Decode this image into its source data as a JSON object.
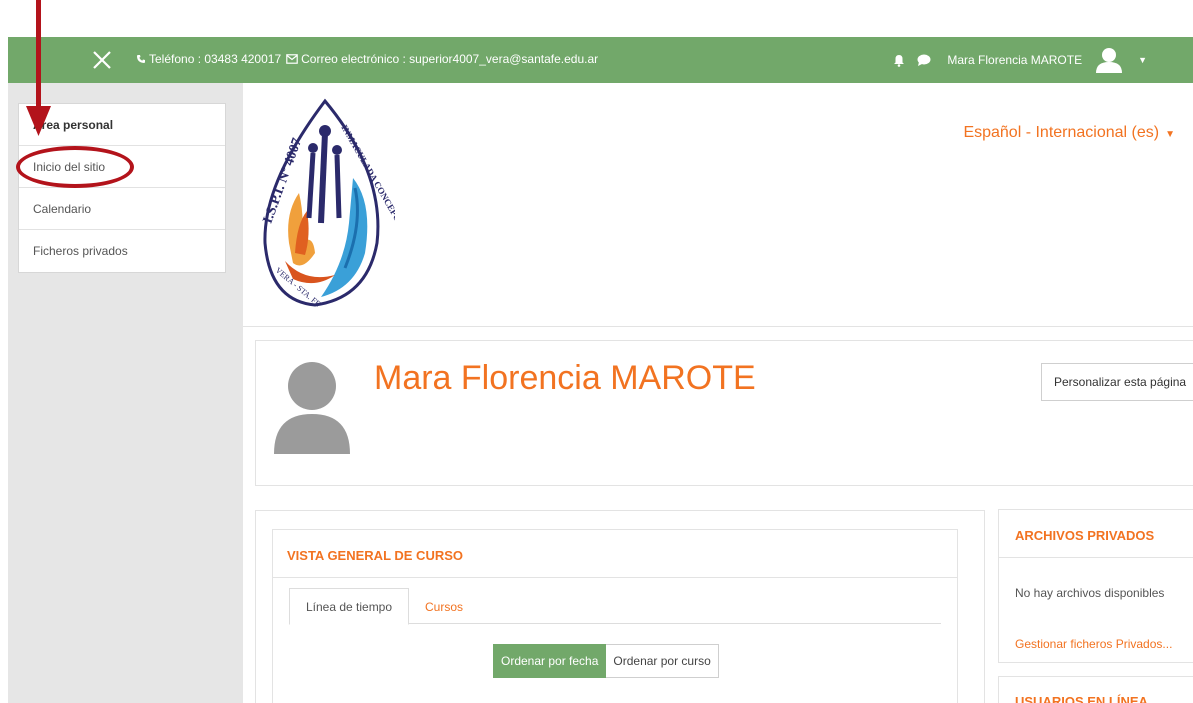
{
  "topbar": {
    "phone_label": "Teléfono : 03483 420017",
    "email_label": "Correo electrónico : superior4007_vera@santafe.edu.ar",
    "user_name": "Mara Florencia MAROTE",
    "icons": [
      "close-icon",
      "phone-icon",
      "mail-icon",
      "bell-icon",
      "chat-icon",
      "user-avatar-icon",
      "caret-down-icon"
    ]
  },
  "sidebar": {
    "items": [
      {
        "label": "Área personal",
        "bold": true
      },
      {
        "label": "Inicio del sitio"
      },
      {
        "label": "Calendario"
      },
      {
        "label": "Ficheros privados"
      }
    ]
  },
  "header": {
    "language": "Español - Internacional (es)",
    "logo_text": {
      "top": "I.S.P.I. Nº 4007",
      "right": "INMACULADA CONCEPCION",
      "bottom": "VERA - STA. FE"
    }
  },
  "profile": {
    "name": "Mara Florencia MAROTE",
    "customize_label": "Personalizar esta página"
  },
  "course_overview": {
    "title": "VISTA GENERAL DE CURSO",
    "tabs": [
      "Línea de tiempo",
      "Cursos"
    ],
    "sort_by_date": "Ordenar por fecha",
    "sort_by_course": "Ordenar por curso"
  },
  "private_files": {
    "title": "ARCHIVOS PRIVADOS",
    "empty_text": "No hay archivos disponibles",
    "manage_link": "Gestionar ficheros Privados..."
  },
  "online_users": {
    "title": "USUARIOS EN LÍNEA"
  },
  "colors": {
    "topbar": "#72a86a",
    "accent_orange": "#f27321",
    "annotation_red": "#b3131b",
    "sidebar_bg": "#e6e6e6"
  }
}
